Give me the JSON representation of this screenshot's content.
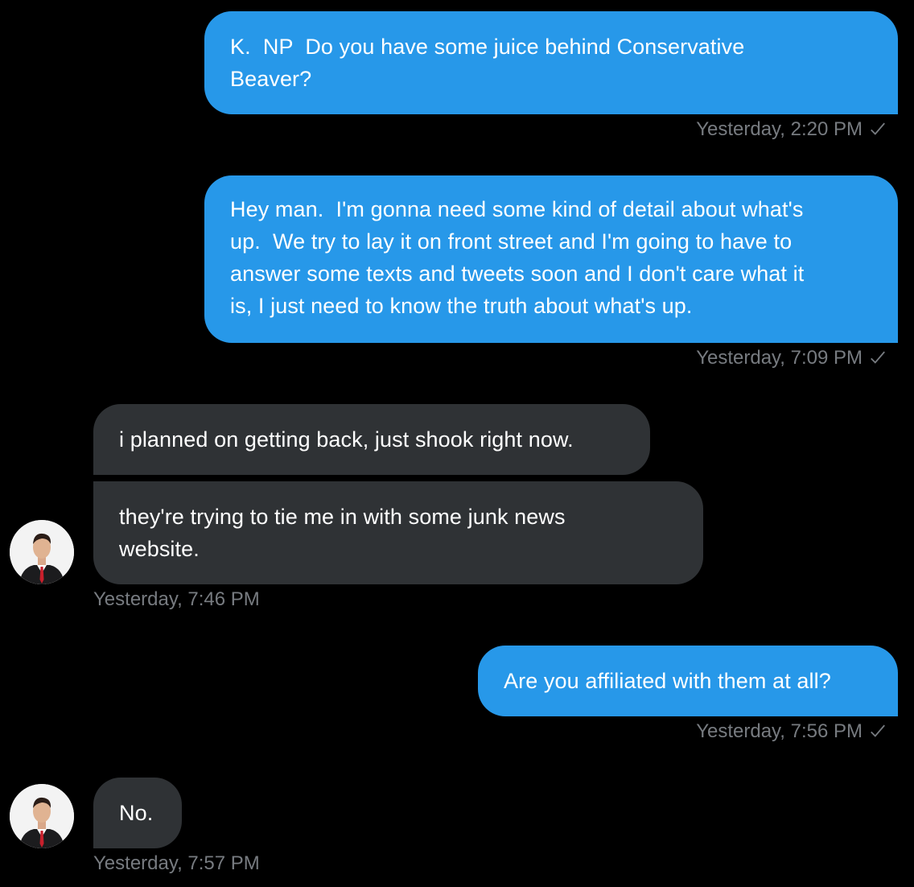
{
  "messages": [
    {
      "id": "m1",
      "direction": "sent",
      "text": "K.  NP  Do you have some juice behind Conservative\nBeaver?",
      "timestamp": "Yesterday, 2:20 PM",
      "status": "sent-check-icon"
    },
    {
      "id": "m2",
      "direction": "sent",
      "text": "Hey man.  I'm gonna need some kind of detail about what's\nup.  We try to lay it on front street and I'm going to have to\nanswer some texts and tweets soon and I don't care what it\nis, I just need to know the truth about what's up.",
      "timestamp": "Yesterday, 7:09 PM",
      "status": "sent-check-icon"
    },
    {
      "id": "m3",
      "direction": "received",
      "text": "i planned on getting back, just shook right now.",
      "timestamp": null
    },
    {
      "id": "m4",
      "direction": "received",
      "text": "they're trying to tie me in with some junk news\nwebsite.",
      "timestamp": "Yesterday, 7:46 PM"
    },
    {
      "id": "m5",
      "direction": "sent",
      "text": "Are you affiliated with them at all?",
      "timestamp": "Yesterday, 7:56 PM",
      "status": "sent-check-icon"
    },
    {
      "id": "m6",
      "direction": "received",
      "text": "No.",
      "timestamp": "Yesterday, 7:57 PM"
    }
  ],
  "colors": {
    "background": "#000000",
    "sent_bubble": "#2798e9",
    "received_bubble": "#2f3235",
    "timestamp": "#777b80",
    "text": "#ffffff"
  }
}
